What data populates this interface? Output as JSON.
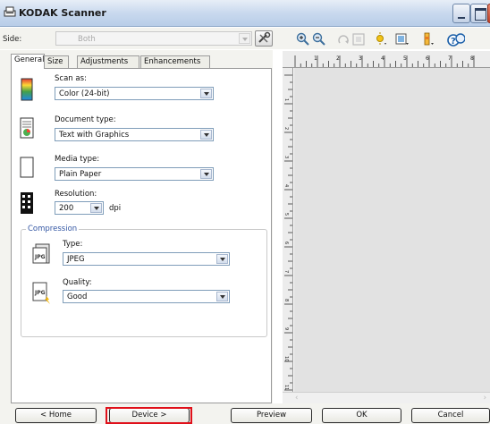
{
  "window": {
    "title": "KODAK Scanner"
  },
  "toolbar": {
    "side_label": "Side:",
    "side_value": "Both",
    "tools": [
      "zoom-in-icon",
      "zoom-out-icon",
      "rotate-icon",
      "fit-page-icon",
      "brightness-icon",
      "crop-preview-icon",
      "color-icon",
      "help-icon"
    ]
  },
  "tabs": [
    {
      "label": "General",
      "active": true
    },
    {
      "label": "Size",
      "active": false
    },
    {
      "label": "Adjustments",
      "active": false
    },
    {
      "label": "Enhancements",
      "active": false
    }
  ],
  "general": {
    "scan_as": {
      "label": "Scan as:",
      "value": "Color (24-bit)"
    },
    "document_type": {
      "label": "Document type:",
      "value": "Text with Graphics"
    },
    "media_type": {
      "label": "Media type:",
      "value": "Plain Paper"
    },
    "resolution": {
      "label": "Resolution:",
      "value": "200",
      "unit": "dpi"
    },
    "compression": {
      "title": "Compression",
      "type": {
        "label": "Type:",
        "value": "JPEG"
      },
      "quality": {
        "label": "Quality:",
        "value": "Good"
      }
    }
  },
  "ruler": {
    "top_marks": [
      "1",
      "2",
      "3",
      "4",
      "5",
      "6",
      "7",
      "8"
    ],
    "left_marks": [
      "1",
      "2",
      "3",
      "4",
      "5",
      "6",
      "7",
      "8",
      "9",
      "10",
      "11"
    ]
  },
  "buttons": {
    "home": "< Home",
    "device": "Device >",
    "preview": "Preview",
    "ok": "OK",
    "cancel": "Cancel"
  },
  "colors": {
    "highlight": "#e0101a",
    "accent": "#3457a4"
  }
}
